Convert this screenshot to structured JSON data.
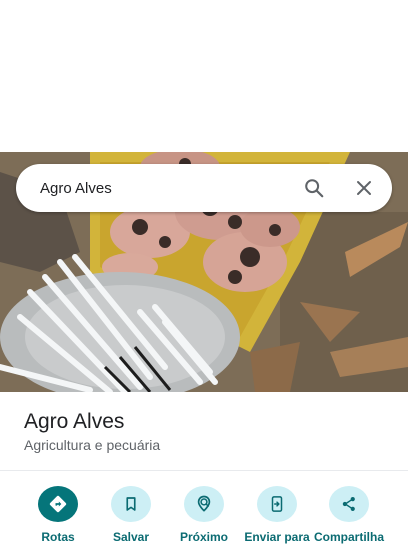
{
  "search": {
    "query": "Agro Alves"
  },
  "place": {
    "title": "Agro Alves",
    "category": "Agricultura e pecuária"
  },
  "actions": [
    {
      "label": "Rotas",
      "icon": "directions-icon"
    },
    {
      "label": "Salvar",
      "icon": "bookmark-icon"
    },
    {
      "label": "Próximo",
      "icon": "nearby-icon"
    },
    {
      "label": "Enviar para",
      "icon": "send-to-phone-icon"
    },
    {
      "label": "Compartilha",
      "icon": "share-icon"
    }
  ],
  "colors": {
    "primary_action": "#05757a",
    "action_bg": "#cdeff5",
    "action_label": "#0b6b72"
  }
}
